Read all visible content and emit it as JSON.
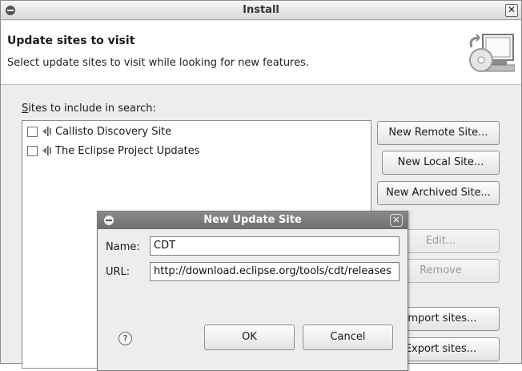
{
  "window": {
    "title": "Install"
  },
  "header": {
    "title": "Update sites to visit",
    "subtitle": "Select update sites to visit while looking for new features."
  },
  "sites": {
    "label_prefix": "S",
    "label_rest": "ites to include in search:",
    "items": [
      {
        "label": "Callisto Discovery Site",
        "checked": false
      },
      {
        "label": "The Eclipse Project Updates",
        "checked": false
      }
    ]
  },
  "buttons": {
    "new_remote": "New Remote Site...",
    "new_local": "New Local Site...",
    "new_archived": "New Archived Site...",
    "edit": "Edit...",
    "remove": "Remove",
    "import": "Import sites...",
    "export": "Export sites..."
  },
  "dialog": {
    "title": "New Update Site",
    "name_label": "Name:",
    "name_value": "CDT",
    "url_label": "URL:",
    "url_value": "http://download.eclipse.org/tools/cdt/releases",
    "ok": "OK",
    "cancel": "Cancel",
    "help": "?"
  },
  "icons": {
    "window_menu": "window-menu-icon",
    "close": "close-icon",
    "install_graphic": "install-banner-icon",
    "site": "update-site-icon",
    "help": "help-icon"
  }
}
